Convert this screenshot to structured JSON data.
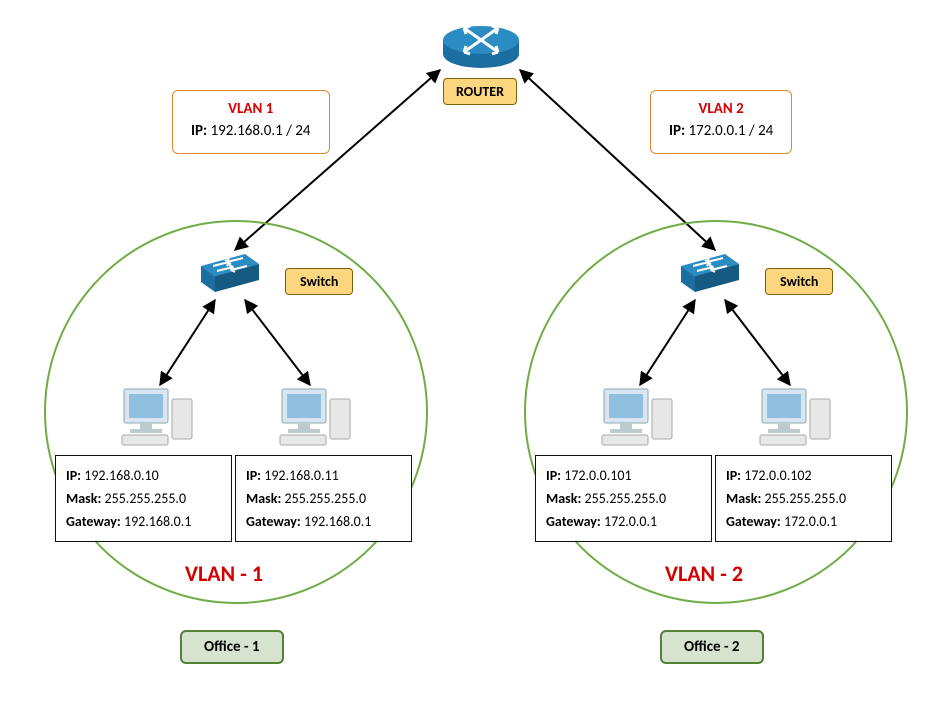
{
  "router": {
    "label": "ROUTER"
  },
  "vlan_boxes": {
    "left": {
      "title": "VLAN 1",
      "ip_label": "IP:",
      "ip": "192.168.0.1 / 24"
    },
    "right": {
      "title": "VLAN 2",
      "ip_label": "IP:",
      "ip": "172.0.0.1 / 24"
    }
  },
  "switches": {
    "left": {
      "label": "Switch"
    },
    "right": {
      "label": "Switch"
    }
  },
  "zones": {
    "left": {
      "vlan_label": "VLAN - 1",
      "office_label": "Office - 1"
    },
    "right": {
      "vlan_label": "VLAN - 2",
      "office_label": "Office - 2"
    }
  },
  "pcs": {
    "l1": {
      "ip_k": "IP:",
      "ip": "192.168.0.10",
      "mask_k": "Mask:",
      "mask": "255.255.255.0",
      "gw_k": "Gateway:",
      "gw": "192.168.0.1"
    },
    "l2": {
      "ip_k": "IP:",
      "ip": "192.168.0.11",
      "mask_k": "Mask:",
      "mask": "255.255.255.0",
      "gw_k": "Gateway:",
      "gw": "192.168.0.1"
    },
    "r1": {
      "ip_k": "IP:",
      "ip": "172.0.0.101",
      "mask_k": "Mask:",
      "mask": "255.255.255.0",
      "gw_k": "Gateway:",
      "gw": "172.0.0.1"
    },
    "r2": {
      "ip_k": "IP:",
      "ip": "172.0.0.102",
      "mask_k": "Mask:",
      "mask": "255.255.255.0",
      "gw_k": "Gateway:",
      "gw": "172.0.0.1"
    }
  }
}
